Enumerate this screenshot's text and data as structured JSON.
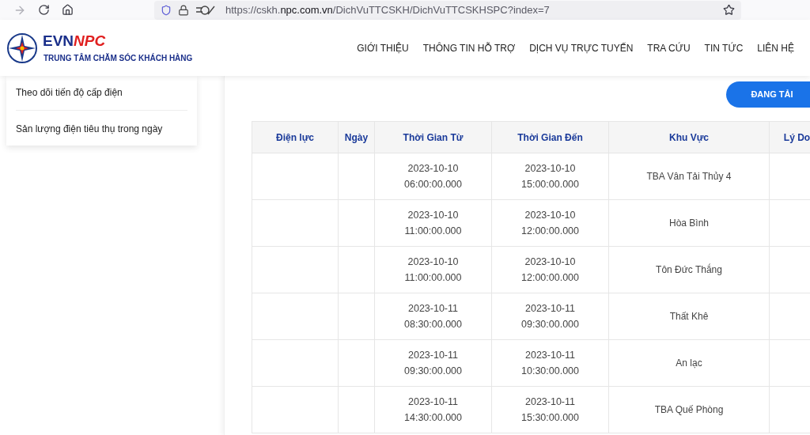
{
  "browser": {
    "url_prefix": "https://cskh.",
    "url_domain": "npc.com.vn",
    "url_path": "/DichVuTTCSKH/DichVuTTCSKHSPC?index=7"
  },
  "logo": {
    "brand_left": "EVN",
    "brand_right": "NPC",
    "subtitle": "TRUNG TÂM CHĂM SÓC KHÁCH HÀNG"
  },
  "nav": [
    "GIỚI THIỆU",
    "THÔNG TIN HỖ TRỢ",
    "DỊCH VỤ TRỰC TUYẾN",
    "TRA CỨU",
    "TIN TỨC",
    "LIÊN HỆ"
  ],
  "sidebar": {
    "items": [
      "Theo dõi tiến độ cấp điện",
      "Sản lượng điện tiêu thụ trong ngày"
    ]
  },
  "loading_button": "ĐANG TẢI",
  "table": {
    "columns": [
      "Điện lực",
      "Ngày",
      "Thời Gian Từ",
      "Thời Gian Đến",
      "Khu Vực",
      "Lý Do"
    ],
    "rows": [
      {
        "from_date": "2023-10-10",
        "from_time": "06:00:00.000",
        "to_date": "2023-10-10",
        "to_time": "15:00:00.000",
        "area": "TBA Vân Tải Thủy 4"
      },
      {
        "from_date": "2023-10-10",
        "from_time": "11:00:00.000",
        "to_date": "2023-10-10",
        "to_time": "12:00:00.000",
        "area": "Hòa Bình"
      },
      {
        "from_date": "2023-10-10",
        "from_time": "11:00:00.000",
        "to_date": "2023-10-10",
        "to_time": "12:00:00.000",
        "area": "Tôn Đức Thắng"
      },
      {
        "from_date": "2023-10-11",
        "from_time": "08:30:00.000",
        "to_date": "2023-10-11",
        "to_time": "09:30:00.000",
        "area": "Thất Khê"
      },
      {
        "from_date": "2023-10-11",
        "from_time": "09:30:00.000",
        "to_date": "2023-10-11",
        "to_time": "10:30:00.000",
        "area": "An lạc"
      },
      {
        "from_date": "2023-10-11",
        "from_time": "14:30:00.000",
        "to_date": "2023-10-11",
        "to_time": "15:30:00.000",
        "area": "TBA Quế Phòng"
      }
    ]
  }
}
